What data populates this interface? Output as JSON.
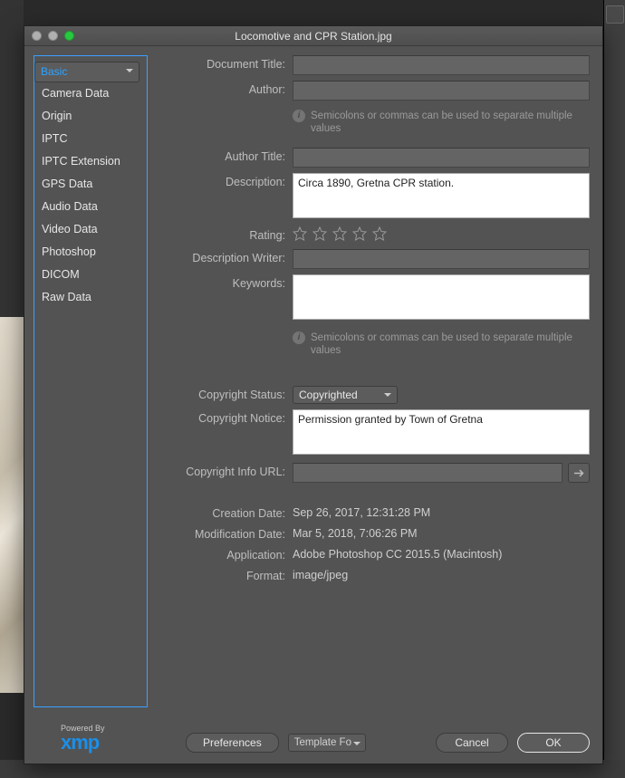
{
  "window": {
    "title": "Locomotive and CPR Station.jpg"
  },
  "sidebar": {
    "tabs": [
      {
        "label": "Basic",
        "selected": true
      },
      {
        "label": "Camera Data"
      },
      {
        "label": "Origin"
      },
      {
        "label": "IPTC"
      },
      {
        "label": "IPTC Extension"
      },
      {
        "label": "GPS Data"
      },
      {
        "label": "Audio Data"
      },
      {
        "label": "Video Data"
      },
      {
        "label": "Photoshop"
      },
      {
        "label": "DICOM"
      },
      {
        "label": "Raw Data"
      }
    ]
  },
  "form": {
    "labels": {
      "doc_title": "Document Title:",
      "author": "Author:",
      "author_title": "Author Title:",
      "description": "Description:",
      "rating": "Rating:",
      "desc_writer": "Description Writer:",
      "keywords": "Keywords:",
      "copy_status": "Copyright Status:",
      "copy_notice": "Copyright Notice:",
      "copy_url": "Copyright Info URL:",
      "creation": "Creation Date:",
      "modification": "Modification Date:",
      "application": "Application:",
      "format": "Format:"
    },
    "values": {
      "doc_title": "",
      "author": "",
      "author_title": "",
      "description": "Circa 1890, Gretna CPR station.",
      "desc_writer": "",
      "keywords": "",
      "copy_status": "Copyrighted",
      "copy_notice": "Permission granted by Town of Gretna",
      "copy_url": "",
      "creation": "Sep 26, 2017, 12:31:28 PM",
      "modification": "Mar 5, 2018, 7:06:26 PM",
      "application": "Adobe Photoshop CC 2015.5 (Macintosh)",
      "format": "image/jpeg"
    },
    "hints": {
      "separator": "Semicolons or commas can be used to separate multiple values"
    },
    "rating": 0
  },
  "footer": {
    "powered_by": "Powered By",
    "logo": "xmp",
    "preferences": "Preferences",
    "template": "Template Fo",
    "cancel": "Cancel",
    "ok": "OK"
  }
}
